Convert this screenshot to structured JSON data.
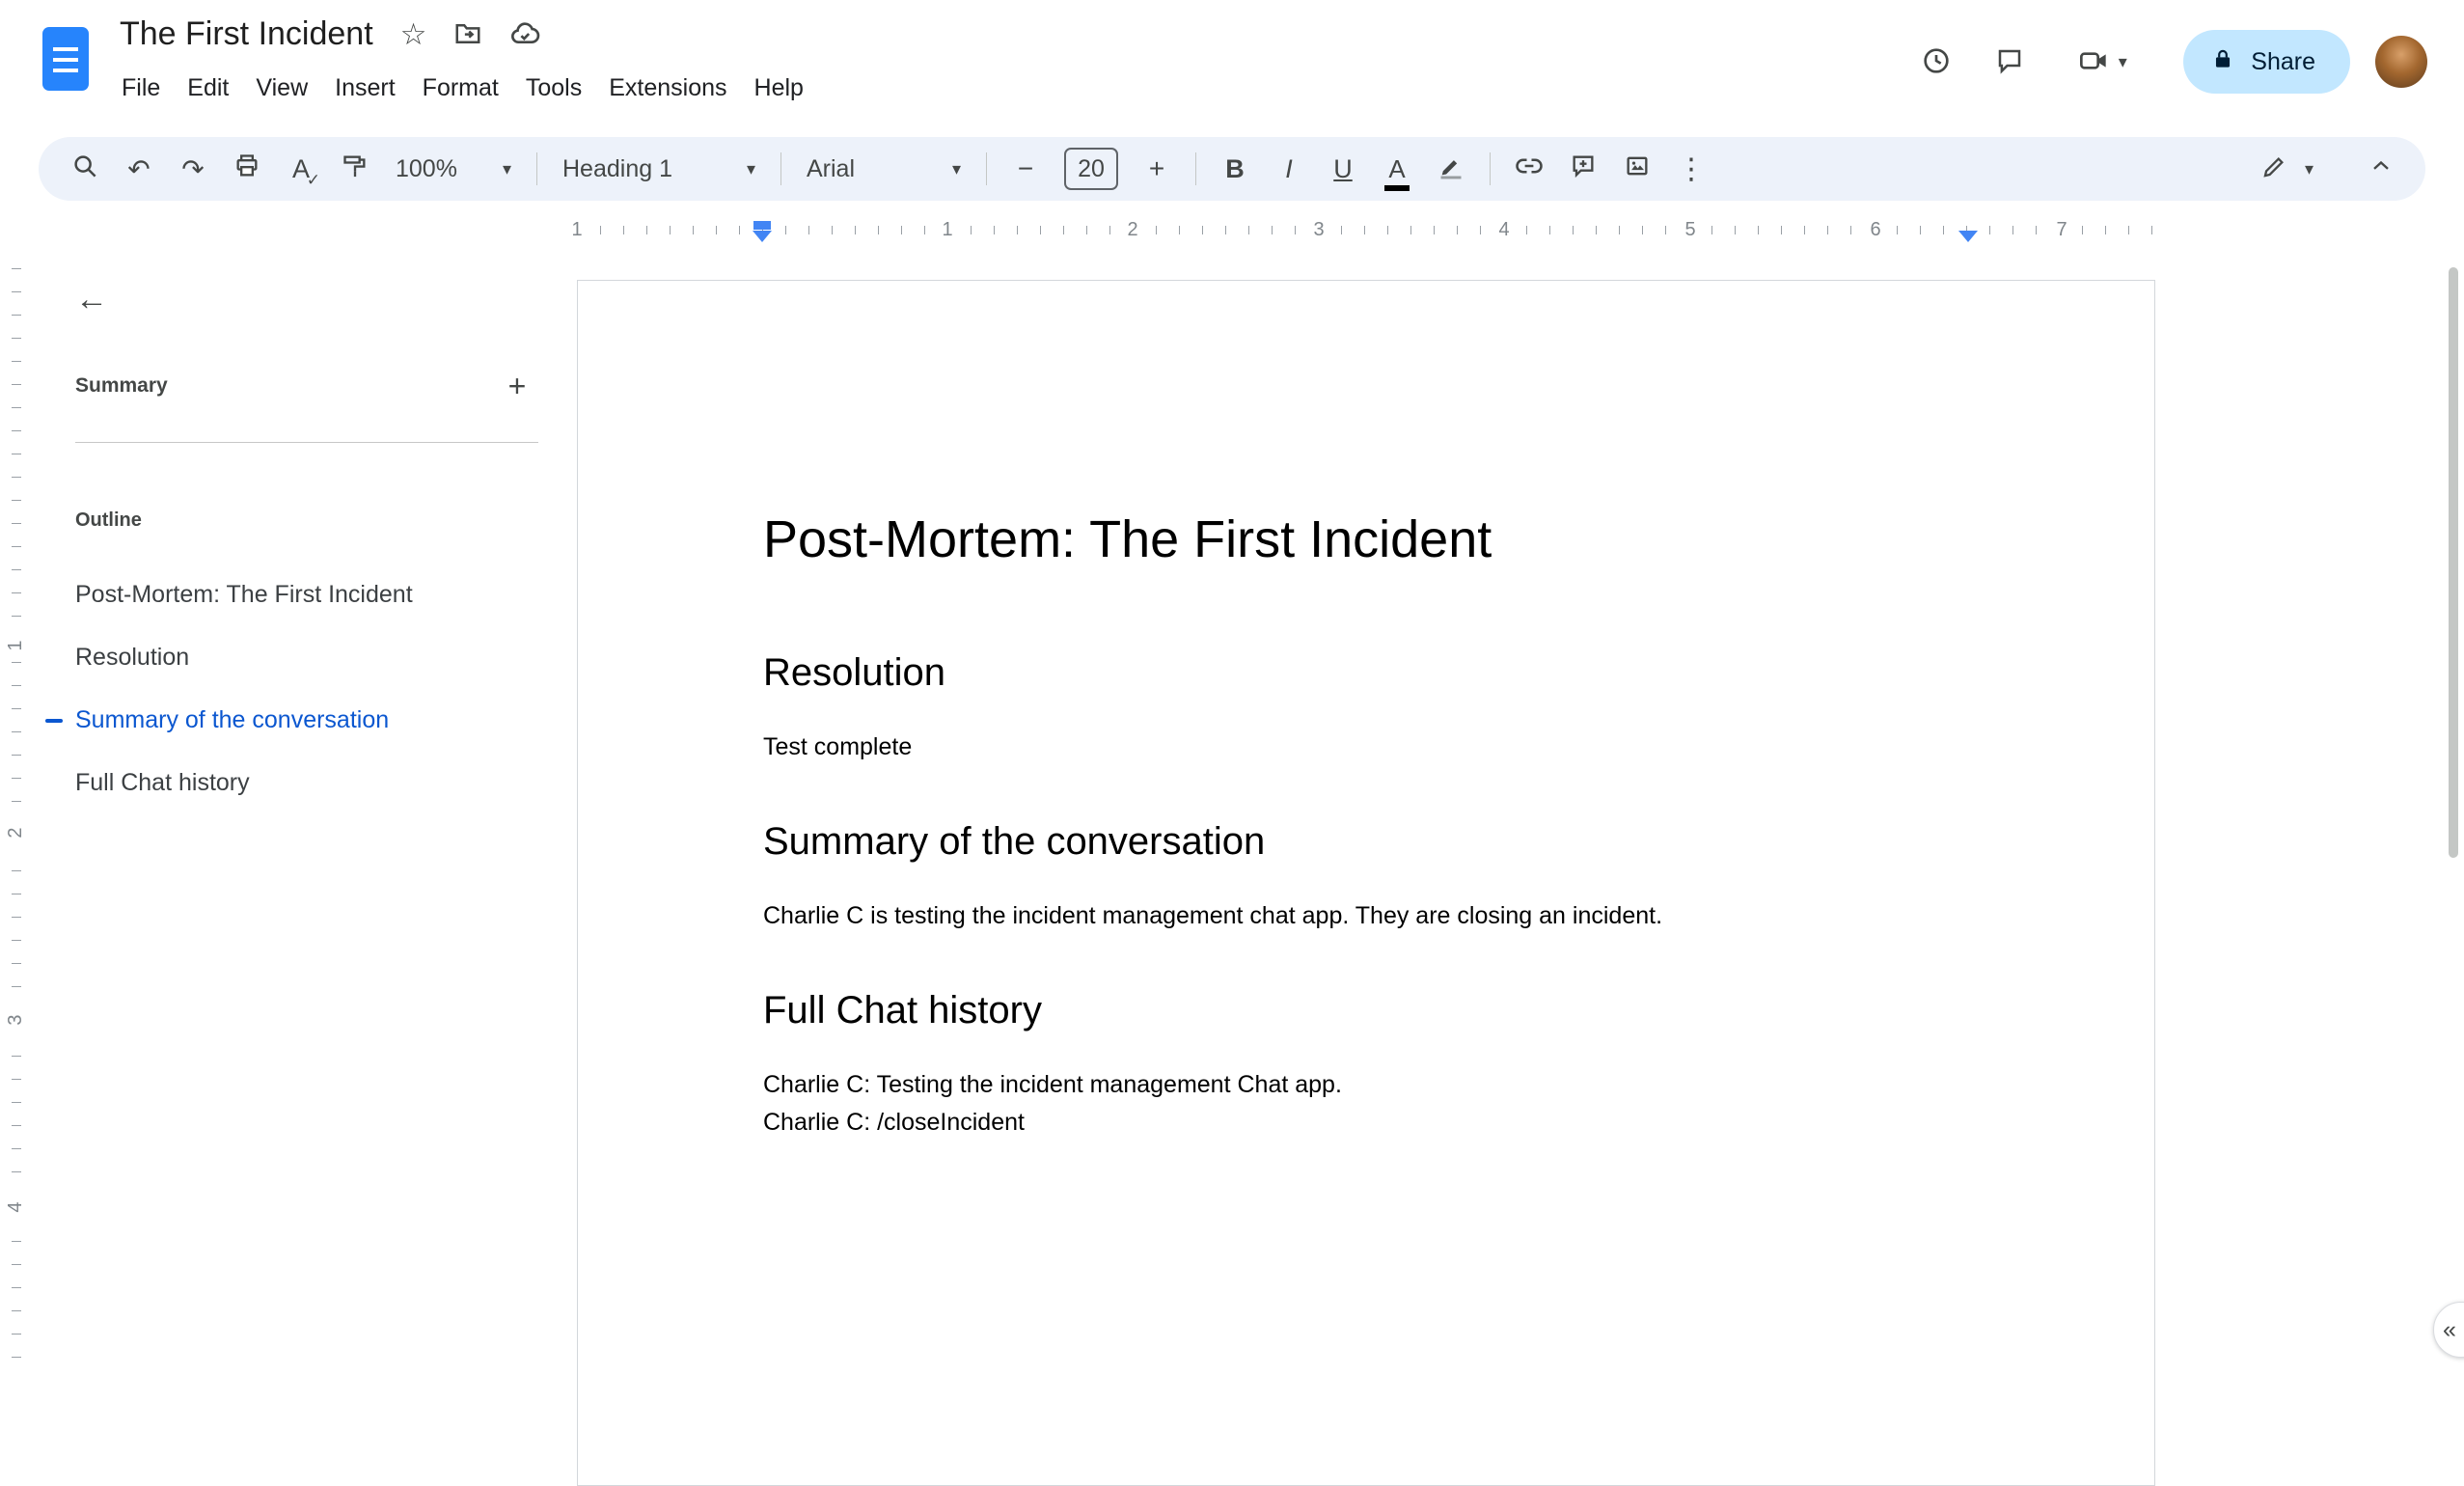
{
  "header": {
    "title": "The First Incident",
    "menus": [
      "File",
      "Edit",
      "View",
      "Insert",
      "Format",
      "Tools",
      "Extensions",
      "Help"
    ],
    "share": "Share"
  },
  "toolbar": {
    "undo": "↶",
    "redo": "↷",
    "zoom": "100%",
    "styles": "Heading 1",
    "font": "Arial",
    "minus": "−",
    "size": "20",
    "plus": "+",
    "bold": "B",
    "italic": "I",
    "underline": "U",
    "text_color": "A",
    "spell_letter": "A",
    "check": "✓",
    "more": "⋮"
  },
  "glyphs": {
    "star": "☆",
    "caret": "▾",
    "back": "←",
    "add": "+",
    "collapse": "«"
  },
  "ruler": {
    "h": [
      "1",
      "1",
      "2",
      "3",
      "4",
      "5",
      "6",
      "7"
    ],
    "v": [
      "1",
      "2",
      "3",
      "4"
    ]
  },
  "outline": {
    "summary_label": "Summary",
    "outline_label": "Outline",
    "items": [
      {
        "label": "Post-Mortem: The First Incident",
        "active": false
      },
      {
        "label": "Resolution",
        "active": false
      },
      {
        "label": "Summary of the conversation",
        "active": true
      },
      {
        "label": "Full Chat history",
        "active": false
      }
    ]
  },
  "document": {
    "title": "Post-Mortem: The First Incident",
    "sections": [
      {
        "heading": "Resolution",
        "paragraphs": [
          "Test complete"
        ]
      },
      {
        "heading": "Summary of the conversation",
        "paragraphs": [
          "Charlie C is testing the incident management chat app. They are closing an incident."
        ]
      },
      {
        "heading": "Full Chat history",
        "paragraphs": [
          "Charlie C: Testing the incident management Chat app.",
          "Charlie C: /closeIncident"
        ]
      }
    ]
  },
  "colors": {
    "accent": "#0b57d0",
    "toolbar_bg": "#edf2fa",
    "share_bg": "#c2e7ff",
    "share_text": "#001d35",
    "docs_icon": "#2684fc",
    "ruler_marker": "#4285f4"
  }
}
